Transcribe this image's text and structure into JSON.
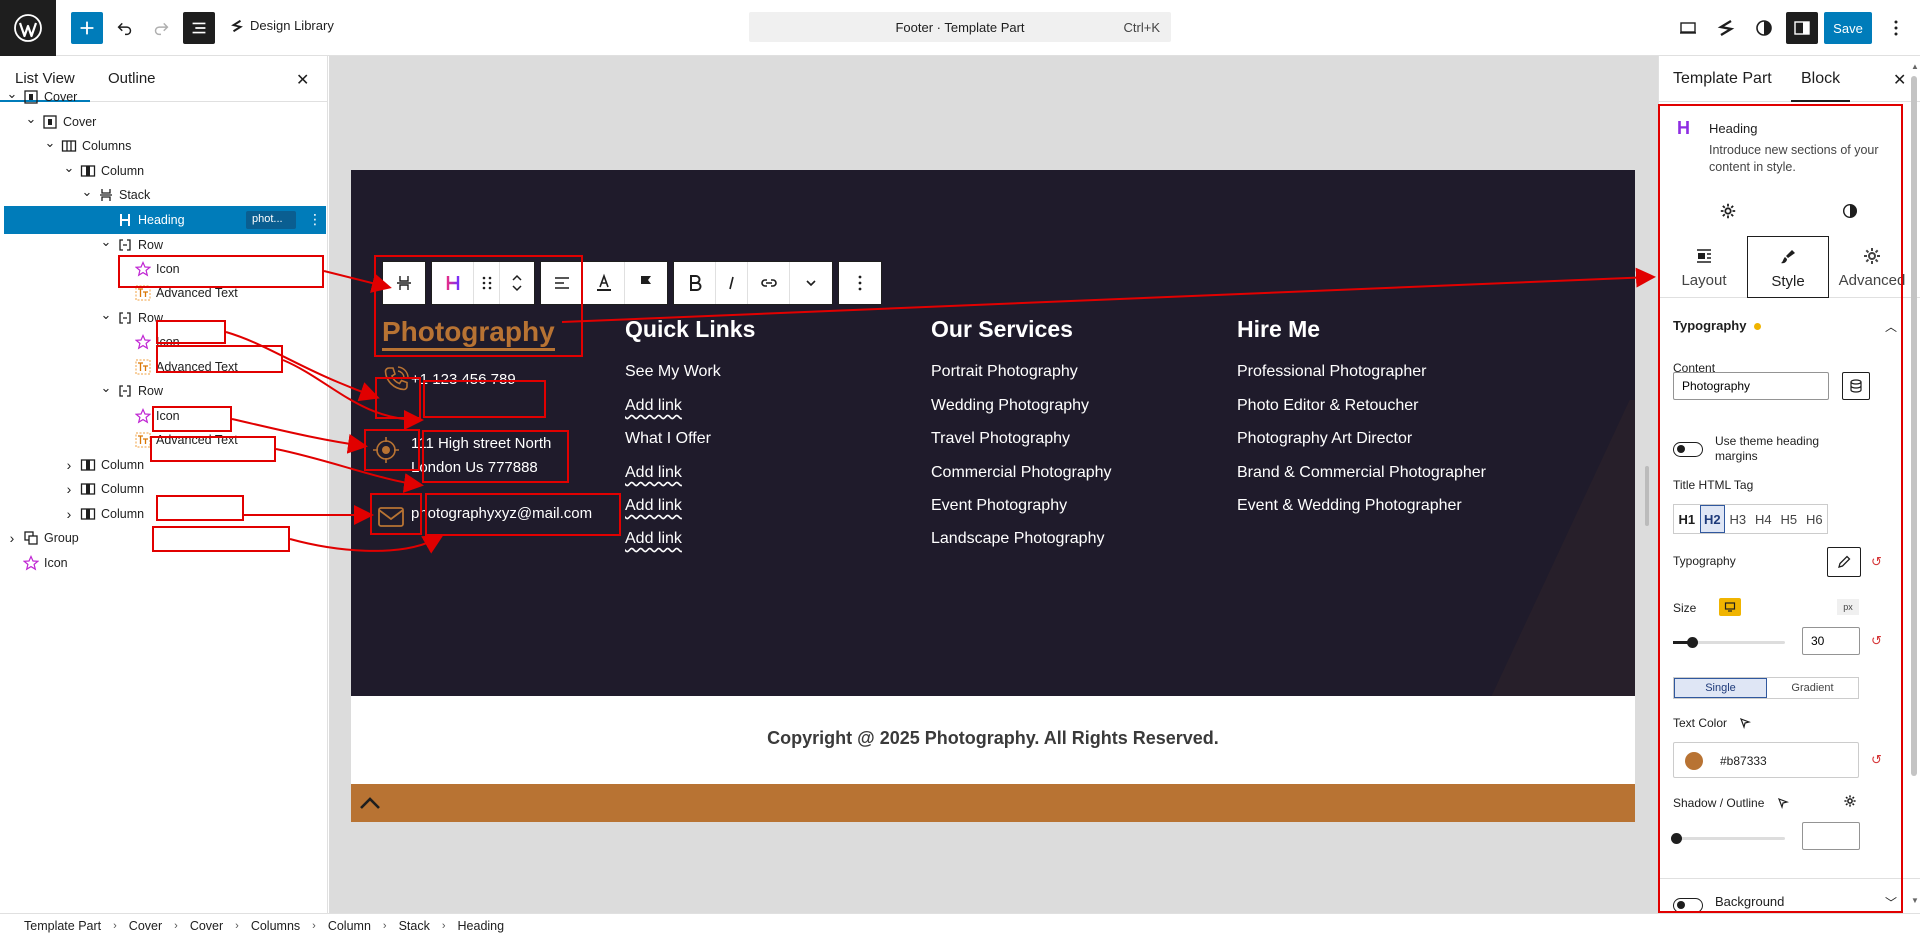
{
  "topbar": {
    "design_library": "Design Library",
    "command": {
      "title": "Footer · Template Part",
      "shortcut": "Ctrl+K"
    },
    "save_label": "Save"
  },
  "list_panel": {
    "tabs": [
      "List View",
      "Outline"
    ],
    "tree": [
      {
        "label": "Cover",
        "icon": "cover-icon",
        "depth": 0,
        "expanded": true
      },
      {
        "label": "Cover",
        "icon": "cover-icon",
        "depth": 1,
        "expanded": true
      },
      {
        "label": "Columns",
        "icon": "columns-icon",
        "depth": 2,
        "expanded": true
      },
      {
        "label": "Column",
        "icon": "column-icon",
        "depth": 3,
        "expanded": true
      },
      {
        "label": "Stack",
        "icon": "stack-icon",
        "depth": 4,
        "expanded": true
      },
      {
        "label": "Heading",
        "icon": "heading-icon",
        "depth": 5,
        "selected": true,
        "badge": "phot..."
      },
      {
        "label": "Row",
        "icon": "row-icon",
        "depth": 5,
        "expanded": true
      },
      {
        "label": "Icon",
        "icon": "star-icon",
        "depth": 6
      },
      {
        "label": "Advanced Text",
        "icon": "advanced-text-icon",
        "depth": 6
      },
      {
        "label": "Row",
        "icon": "row-icon",
        "depth": 5,
        "expanded": true
      },
      {
        "label": "Icon",
        "icon": "star-icon",
        "depth": 6
      },
      {
        "label": "Advanced Text",
        "icon": "advanced-text-icon",
        "depth": 6
      },
      {
        "label": "Row",
        "icon": "row-icon",
        "depth": 5,
        "expanded": true
      },
      {
        "label": "Icon",
        "icon": "star-icon",
        "depth": 6
      },
      {
        "label": "Advanced Text",
        "icon": "advanced-text-icon",
        "depth": 6
      },
      {
        "label": "Column",
        "icon": "column-icon",
        "depth": 3,
        "expanded": false
      },
      {
        "label": "Column",
        "icon": "column-icon",
        "depth": 3,
        "expanded": false
      },
      {
        "label": "Column",
        "icon": "column-icon",
        "depth": 3,
        "expanded": false
      },
      {
        "label": "Group",
        "icon": "group-icon",
        "depth": 0,
        "expanded": false
      },
      {
        "label": "Icon",
        "icon": "star-icon",
        "depth": 0,
        "leaf": true
      }
    ]
  },
  "canvas": {
    "heading": "Photography",
    "contacts": {
      "phone": "+1 123 456 789",
      "address_line1": "111 High street North",
      "address_line2": "London Us 777888",
      "email": "photographyxyz@mail.com"
    },
    "quick_links": {
      "title": "Quick Links",
      "items": [
        "See My Work",
        "Add link",
        "What I Offer",
        "Add link",
        "Add link",
        "Add link"
      ]
    },
    "services": {
      "title": "Our Services",
      "items": [
        "Portrait Photography",
        "Wedding Photography",
        "Travel Photography",
        "Commercial Photography",
        "Event Photography",
        "Landscape Photography"
      ]
    },
    "hire": {
      "title": "Hire Me",
      "items": [
        "Professional Photographer",
        "Photo Editor & Retoucher",
        "Photography Art Director",
        "Brand & Commercial Photographer",
        "Event & Wedding Photographer"
      ]
    },
    "copyright": "Copyright @ 2025 Photography. All Rights Reserved."
  },
  "settings_panel": {
    "tabs": [
      "Template Part",
      "Block"
    ],
    "block_name": "Heading",
    "block_desc": "Introduce new sections of your content in style.",
    "segments": [
      "Layout",
      "Style",
      "Advanced"
    ],
    "typography_title": "Typography",
    "content_label": "Content",
    "content_value": "Photography",
    "theme_margins_label": "Use theme heading margins",
    "html_tag_label": "Title HTML Tag",
    "html_tags": [
      "H1",
      "H2",
      "H3",
      "H4",
      "H5",
      "H6"
    ],
    "typography_label": "Typography",
    "size_label": "Size",
    "size_unit": "px",
    "size_value": "30",
    "size_fraction": 0.17,
    "fill_modes": [
      "Single",
      "Gradient"
    ],
    "text_color_label": "Text Color",
    "text_color_value": "#b87333",
    "shadow_label": "Shadow / Outline",
    "background_label": "Background"
  },
  "breadcrumb": [
    "Template Part",
    "Cover",
    "Cover",
    "Columns",
    "Column",
    "Stack",
    "Heading"
  ],
  "colors": {
    "accent": "#007cba",
    "brand": "#b87333",
    "footer_bg": "#1f1b2b",
    "annotation": "#e10000"
  }
}
